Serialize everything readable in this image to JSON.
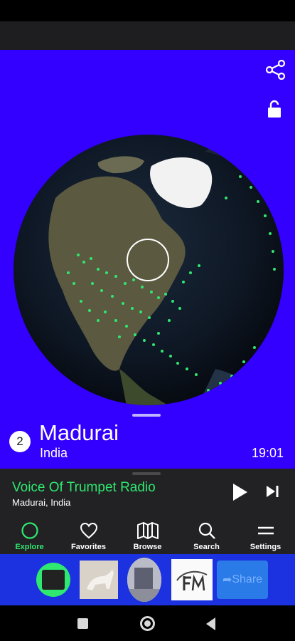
{
  "city": {
    "count": "2",
    "name": "Madurai",
    "country": "India",
    "time": "19:01"
  },
  "player": {
    "station_name": "Voice Of Trumpet Radio",
    "station_location": "Madurai, India"
  },
  "tabs": [
    {
      "label": "Explore",
      "icon": "circle-icon",
      "active": true
    },
    {
      "label": "Favorites",
      "icon": "heart-icon",
      "active": false
    },
    {
      "label": "Browse",
      "icon": "map-icon",
      "active": false
    },
    {
      "label": "Search",
      "icon": "search-icon",
      "active": false
    },
    {
      "label": "Settings",
      "icon": "menu-icon",
      "active": false
    }
  ],
  "ad_bar": {
    "share_label": "Share"
  },
  "colors": {
    "accent": "#2ee86f",
    "globe_background": "#3300ff",
    "panel_dark": "#222224",
    "ad_bar": "#1c32e0"
  }
}
